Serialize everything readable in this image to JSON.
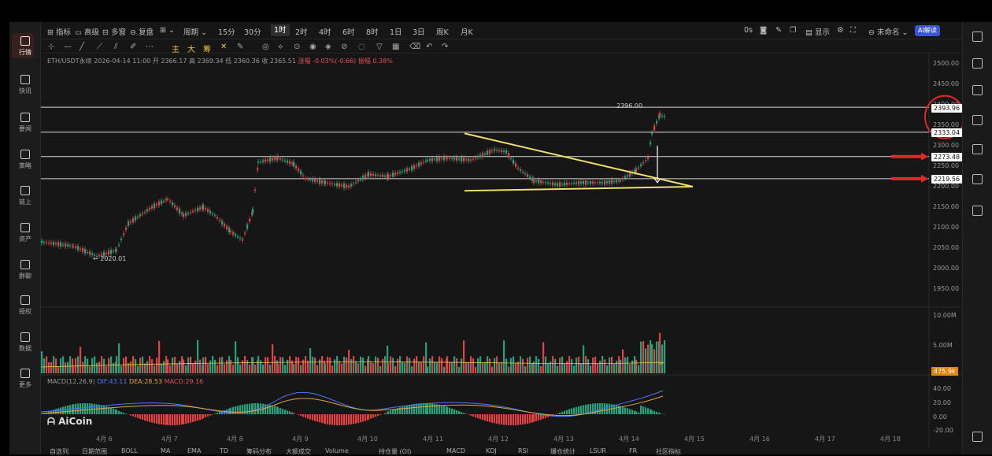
{
  "toolbar": {
    "left_items": [
      "指标",
      "高级",
      "多窗",
      "复盘",
      "周期"
    ],
    "intervals": [
      "15分",
      "30分",
      "1时",
      "2时",
      "4时",
      "6时",
      "8时",
      "1日",
      "3日",
      "周K",
      "月K"
    ],
    "active_interval": "1时",
    "right_items": [
      "0s",
      "显示",
      "未命名"
    ],
    "ai_button": "AI解读"
  },
  "symbol_info": {
    "pair": "ETH/USDT永续",
    "datetime": "2026-04-14 11:00",
    "open": "开 2366.17",
    "high": "高 2369.34",
    "low": "低 2360.36",
    "close": "收 2365.51",
    "change": "涨幅 -0.03%(-0.66)",
    "amplitude": "振幅 0.38%"
  },
  "sidebar": [
    {
      "label": "行情"
    },
    {
      "label": "快讯"
    },
    {
      "label": "要闻"
    },
    {
      "label": "策略"
    },
    {
      "label": "链上"
    },
    {
      "label": "资产"
    },
    {
      "label": "群聊"
    },
    {
      "label": "授权"
    },
    {
      "label": "数据"
    },
    {
      "label": "更多"
    }
  ],
  "price_axis": {
    "labels": [
      "2500.00",
      "2450.00",
      "2400.00",
      "2350.00",
      "2300.00",
      "2250.00",
      "2200.00",
      "2150.00",
      "2100.00",
      "2050.00",
      "2000.00",
      "1950.00"
    ],
    "tags": [
      "2393.96",
      "2333.04",
      "2273.48",
      "2219.56"
    ]
  },
  "annotations": {
    "high_marker": "2396.00",
    "low_marker": "← 2020.01"
  },
  "volume": {
    "labels": [
      "10.00M",
      "5.00M"
    ],
    "current_tag": "475.9k"
  },
  "macd": {
    "title": "MACD(12,26,9)",
    "dif": "DIF:43.11",
    "dea": "DEA:28.53",
    "macd": "MACD:29.16",
    "labels": [
      "40.00",
      "20.00",
      "0.00",
      "-20.00"
    ]
  },
  "dates": [
    "4月 6",
    "4月 7",
    "4月 8",
    "4月 9",
    "4月 10",
    "4月 11",
    "4月 12",
    "4月 13",
    "4月 14",
    "4月 15",
    "4月 16",
    "4月 17",
    "4月 18"
  ],
  "logo": "AiCoin",
  "bottombar": [
    "自选列",
    "日期范围",
    "BOLL",
    "MA",
    "EMA",
    "TD",
    "筹码分布",
    "大额成交",
    "Volume",
    "持仓量 (OI)",
    "MACD",
    "KDJ",
    "RSI",
    "爆仓统计",
    "LSUR",
    "FR",
    "社区指标"
  ],
  "colors": {
    "up": "#26a17b",
    "down": "#e04343",
    "trendline": "#f0e068",
    "level_line": "#d8d8d8",
    "arrow": "#e02828",
    "circle": "#e02828",
    "dif": "#4b78ff",
    "dea": "#e6a23c"
  }
}
